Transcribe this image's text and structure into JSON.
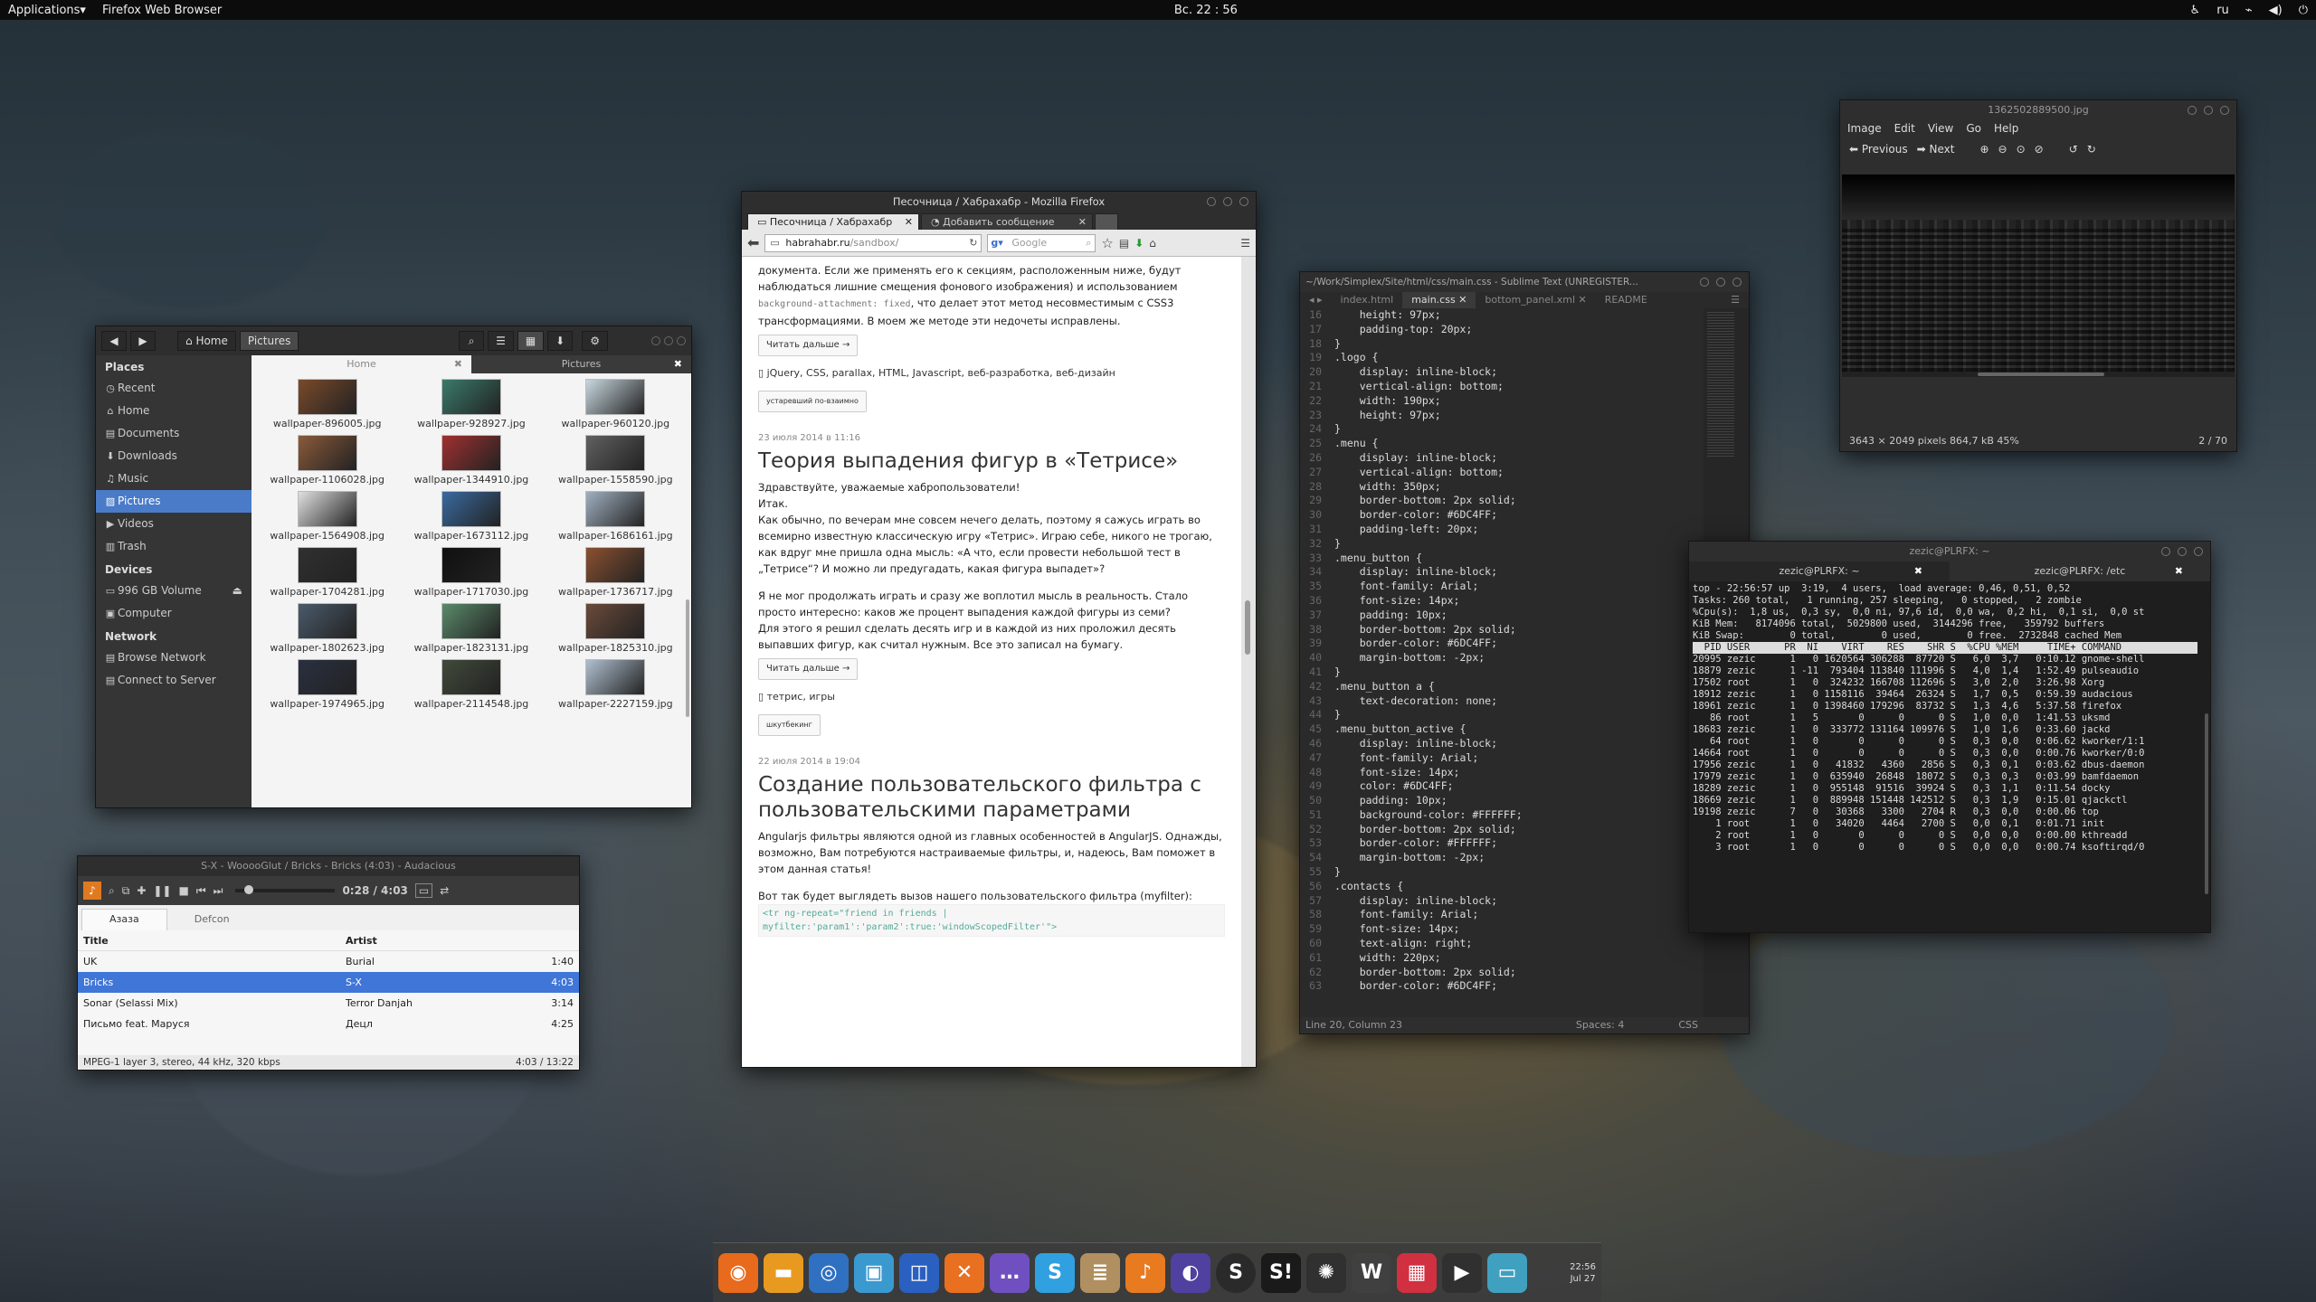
{
  "panel": {
    "applications": "Applications",
    "active_app": "Firefox Web Browser",
    "clock": "Вс. 22 : 56",
    "lang": "ru"
  },
  "files": {
    "toolbar": {
      "home": "Home",
      "pictures": "Pictures"
    },
    "sidebar": {
      "places_header": "Places",
      "places": [
        {
          "label": "Recent",
          "icon": "clock-icon"
        },
        {
          "label": "Home",
          "icon": "home-icon"
        },
        {
          "label": "Documents",
          "icon": "document-icon"
        },
        {
          "label": "Downloads",
          "icon": "download-icon"
        },
        {
          "label": "Music",
          "icon": "music-icon"
        },
        {
          "label": "Pictures",
          "icon": "picture-icon"
        },
        {
          "label": "Videos",
          "icon": "video-icon"
        },
        {
          "label": "Trash",
          "icon": "trash-icon"
        }
      ],
      "devices_header": "Devices",
      "devices": [
        {
          "label": "996 GB Volume"
        },
        {
          "label": "Computer"
        }
      ],
      "network_header": "Network",
      "network": [
        {
          "label": "Browse Network"
        },
        {
          "label": "Connect to Server"
        }
      ]
    },
    "tabs": [
      "Home",
      "Pictures"
    ],
    "thumbs": [
      "wallpaper-896005.jpg",
      "wallpaper-928927.jpg",
      "wallpaper-960120.jpg",
      "wallpaper-1106028.jpg",
      "wallpaper-1344910.jpg",
      "wallpaper-1558590.jpg",
      "wallpaper-1564908.jpg",
      "wallpaper-1673112.jpg",
      "wallpaper-1686161.jpg",
      "wallpaper-1704281.jpg",
      "wallpaper-1717030.jpg",
      "wallpaper-1736717.jpg",
      "wallpaper-1802623.jpg",
      "wallpaper-1823131.jpg",
      "wallpaper-1825310.jpg",
      "wallpaper-1974965.jpg",
      "wallpaper-2114548.jpg",
      "wallpaper-2227159.jpg"
    ],
    "thumb_colors": [
      "#7a4a2a",
      "#3a7a6a",
      "#c8d8e0",
      "#8a5a3a",
      "#a03030",
      "#606060",
      "#e0e0e0",
      "#3a6aa0",
      "#a0b0c0",
      "#303030",
      "#101010",
      "#8a5030",
      "#4a5a6a",
      "#5a8a6a",
      "#6a4a3a",
      "#2a3040",
      "#404a3a",
      "#b0c0d0"
    ]
  },
  "audacious": {
    "title": "S-X - WooooGlut / Bricks - Bricks (4:03) - Audacious",
    "time": "0:28 / 4:03",
    "playlist_tabs": [
      "Азаза",
      "Defcon"
    ],
    "headers": {
      "title": "Title",
      "artist": "Artist"
    },
    "rows": [
      {
        "title": "UK",
        "artist": "Burial",
        "length": "1:40"
      },
      {
        "title": "Bricks",
        "artist": "S-X",
        "length": "4:03"
      },
      {
        "title": "Sonar (Selassi Mix)",
        "artist": "Terror Danjah",
        "length": "3:14"
      },
      {
        "title": "Письмо feat. Маруся",
        "artist": "Децл",
        "length": "4:25"
      }
    ],
    "status_left": "MPEG-1 layer 3, stereo, 44 kHz, 320 kbps",
    "status_right": "4:03 / 13:22"
  },
  "firefox": {
    "title": "Песочница / Хабрахабр - Mozilla Firefox",
    "tabs": [
      "Песочница / Хабрахабр",
      "Добавить сообщение"
    ],
    "url_host": "habrahabr.ru",
    "url_path": "/sandbox/",
    "search_placeholder": "Google",
    "p1": "документа. Если же применять его к секциям, расположенным ниже, будут наблюдаться лишние смещения фонового изображения) и использованием",
    "p1_code": "background-attachment: fixed",
    "p1_rest": ", что делает этот метод несовместимым с CSS3 трансформациями. В моем же методе эти недочеты исправлены.",
    "read_more": "Читать дальше →",
    "tags1": "jQuery, CSS, parallax, HTML, Javascript, веб-разработка, веб-дизайн",
    "flair1": "устаревший по-взаимно",
    "date2": "23 июля 2014 в 11:16",
    "h2": "Теория выпадения фигур в «Тетрисе»",
    "p2a": "Здравствуйте, уважаемые хабропользователи!",
    "p2b": "Итак.",
    "p2c": "Как обычно, по вечерам мне совсем нечего делать, поэтому я сажусь играть во всемирно известную классическую игру «Тетрис». Играю себе, никого не трогаю, как вдруг мне пришла одна мысль: «А что, если провести небольшой тест в „Тетрисе“? И можно ли предугадать, какая фигура выпадет»?",
    "p2d": "Я не мог продолжать играть и сразу же воплотил мысль в реальность. Стало просто интересно: каков же процент выпадения каждой фигуры из семи?",
    "p2e": "Для этого я решил сделать десять игр и в каждой из них проложил десять выпавших фигур, как считал нужным. Все это записал на бумагу.",
    "tags2": "тетрис, игры",
    "flair2": "шкутбекинг",
    "date3": "22 июля 2014 в 19:04",
    "h3": "Создание пользовательского фильтра с пользовательскими параметрами",
    "p3": "Angularjs фильтры являются одной из главных особенностей в AngularJS. Однажды, возможно, Вам потребуются настраиваемые фильтры, и, надеюсь, Вам поможет в этом данная статья!",
    "p3b": "Вот так будет выглядеть вызов нашего пользовательского фильтра (myfilter):",
    "code3": "<tr ng-repeat=\"friend in friends | myfilter:'param1':'param2':true:'windowScopedFilter'\">"
  },
  "sublime": {
    "title": "~/Work/Simplex/Site/html/css/main.css - Sublime Text (UNREGISTER...",
    "tabs": [
      "index.html",
      "main.css",
      "bottom_panel.xml",
      "README"
    ],
    "line_numbers": "16\n17\n18\n19\n20\n21\n22\n23\n24\n25\n26\n27\n28\n29\n30\n31\n32\n33\n34\n35\n36\n37\n38\n39\n40\n41\n42\n43\n44\n45\n46\n47\n48\n49\n50\n51\n52\n53\n54\n55\n56\n57\n58\n59\n60\n61\n62\n63",
    "code": "    height: 97px;\n    padding-top: 20px;\n}\n.logo {\n    display: inline-block;\n    vertical-align: bottom;\n    width: 190px;\n    height: 97px;\n}\n.menu {\n    display: inline-block;\n    vertical-align: bottom;\n    width: 350px;\n    border-bottom: 2px solid;\n    border-color: #6DC4FF;\n    padding-left: 20px;\n}\n.menu_button {\n    display: inline-block;\n    font-family: Arial;\n    font-size: 14px;\n    padding: 10px;\n    border-bottom: 2px solid;\n    border-color: #6DC4FF;\n    margin-bottom: -2px;\n}\n.menu_button a {\n    text-decoration: none;\n}\n.menu_button_active {\n    display: inline-block;\n    font-family: Arial;\n    font-size: 14px;\n    color: #6DC4FF;\n    padding: 10px;\n    background-color: #FFFFFF;\n    border-bottom: 2px solid;\n    border-color: #FFFFFF;\n    margin-bottom: -2px;\n}\n.contacts {\n    display: inline-block;\n    font-family: Arial;\n    font-size: 14px;\n    text-align: right;\n    width: 220px;\n    border-bottom: 2px solid;\n    border-color: #6DC4FF;",
    "status_pos": "Line 20, Column 23",
    "status_spaces": "Spaces: 4",
    "status_syntax": "CSS"
  },
  "viewer": {
    "title": "1362502889500.jpg",
    "menu": [
      "Image",
      "Edit",
      "View",
      "Go",
      "Help"
    ],
    "prev": "Previous",
    "next": "Next",
    "status_left": "3643 × 2049 pixels  864,7 kB   45%",
    "status_right": "2 / 70"
  },
  "terminal": {
    "title": "zezic@PLRFX: ~",
    "tabs": [
      "zezic@PLRFX: ~",
      "zezic@PLRFX: /etc"
    ],
    "summary": "top - 22:56:57 up  3:19,  4 users,  load average: 0,46, 0,51, 0,52\nTasks: 260 total,   1 running, 257 sleeping,   0 stopped,   2 zombie\n%Cpu(s):  1,8 us,  0,3 sy,  0,0 ni, 97,6 id,  0,0 wa,  0,2 hi,  0,1 si,  0,0 st\nKiB Mem:   8174096 total,  5029800 used,  3144296 free,   359792 buffers\nKiB Swap:        0 total,        0 used,        0 free.  2732848 cached Mem\n",
    "header": "  PID USER      PR  NI    VIRT    RES    SHR S  %CPU %MEM     TIME+ COMMAND       ",
    "procs": "20995 zezic      1   0 1620564 306288  87720 S   6,0  3,7   0:10.12 gnome-shell\n18879 zezic      1 -11  793404 113840 111996 S   4,0  1,4   1:52.49 pulseaudio\n17502 root       1   0  324232 166708 112696 S   3,0  2,0   3:26.98 Xorg\n18912 zezic      1   0 1158116  39464  26324 S   1,7  0,5   0:59.39 audacious\n18961 zezic      1   0 1398460 179296  83732 S   1,3  4,6   5:37.58 firefox\n   86 root       1   5       0      0      0 S   1,0  0,0   1:41.53 uksmd\n18683 zezic      1   0  333772 131164 109976 S   1,0  1,6   0:33.60 jackd\n   64 root       1   0       0      0      0 S   0,3  0,0   0:06.62 kworker/1:1\n14664 root       1   0       0      0      0 S   0,3  0,0   0:00.76 kworker/0:0\n17956 zezic      1   0   41832   4360   2856 S   0,3  0,1   0:03.62 dbus-daemon\n17979 zezic      1   0  635940  26848  18072 S   0,3  0,3   0:03.99 bamfdaemon\n18289 zezic      1   0  955148  91516  39924 S   0,3  1,1   0:11.54 docky\n18669 zezic      1   0  889948 151448 142512 S   0,3  1,9   0:15.01 qjackctl\n19198 zezic      7   0   30368   3300   2704 R   0,3  0,0   0:00.06 top\n    1 root       1   0   34020   4464   2700 S   0,0  0,1   0:01.71 init\n    2 root       1   0       0      0      0 S   0,0  0,0   0:00.00 kthreadd\n    3 root       1   0       0      0      0 S   0,0  0,0   0:00.74 ksoftirqd/0"
  },
  "dock": {
    "icons": [
      "firefox-icon",
      "files-icon",
      "blender-icon",
      "image-viewer-icon",
      "virtualbox-icon",
      "xampp-icon",
      "messaging-icon",
      "skype-icon",
      "notes-icon",
      "audacious-icon",
      "globe-icon",
      "steam-icon",
      "sublime-icon",
      "color-wheel-icon",
      "inkscape-icon",
      "keyboard-icon",
      "media-player-icon",
      "image-icon"
    ],
    "icon_glyphs": [
      "◉",
      "▬",
      "◎",
      "▣",
      "◫",
      "✕",
      "…",
      "S",
      "≣",
      "♪",
      "◐",
      "S",
      "S!",
      "✺",
      "W",
      "▦",
      "▶",
      "▭"
    ],
    "icon_colors": [
      "#e86a1c",
      "#e89a20",
      "#3070c0",
      "#3a9ad0",
      "#2a60c0",
      "#e87020",
      "#7050c0",
      "#30a0e0",
      "#b09060",
      "#e87a20",
      "#5040a0",
      "#2a2a2a",
      "#1a1a1a",
      "#303030",
      "#404040",
      "#d03040",
      "#303030",
      "#40a0c0"
    ],
    "clock_time": "22:56",
    "clock_date": "Jul 27"
  }
}
